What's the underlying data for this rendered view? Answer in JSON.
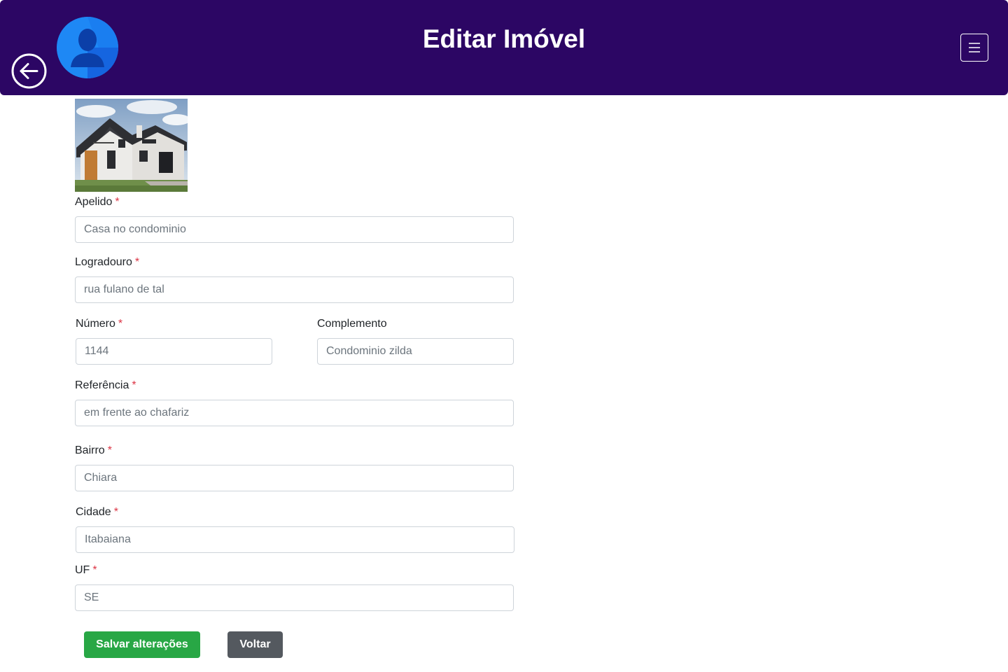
{
  "header": {
    "title": "Editar Imóvel",
    "background_color": "#2c0664",
    "avatar_icon": "user-avatar-icon",
    "back_icon": "arrow-left-circle-icon",
    "menu_icon": "hamburger-menu-icon"
  },
  "form": {
    "apelido": {
      "label": "Apelido",
      "required": "*",
      "value": "Casa no condominio"
    },
    "logradouro": {
      "label": "Logradouro",
      "required": "*",
      "value": "rua fulano de tal"
    },
    "numero": {
      "label": "Número",
      "required": "*",
      "value": "1144"
    },
    "complemento": {
      "label": "Complemento",
      "value": "Condominio zilda"
    },
    "referencia": {
      "label": "Referência",
      "required": "*",
      "value": "em frente ao chafariz"
    },
    "bairro": {
      "label": "Bairro",
      "required": "*",
      "value": "Chiara"
    },
    "cidade": {
      "label": "Cidade",
      "required": "*",
      "value": "Itabaiana"
    },
    "uf": {
      "label": "UF",
      "required": "*",
      "value": "SE"
    }
  },
  "actions": {
    "save_label": "Salvar alterações",
    "back_label": "Voltar",
    "save_color": "#28a745",
    "back_color": "#54595f",
    "required_color": "#dc3545"
  }
}
